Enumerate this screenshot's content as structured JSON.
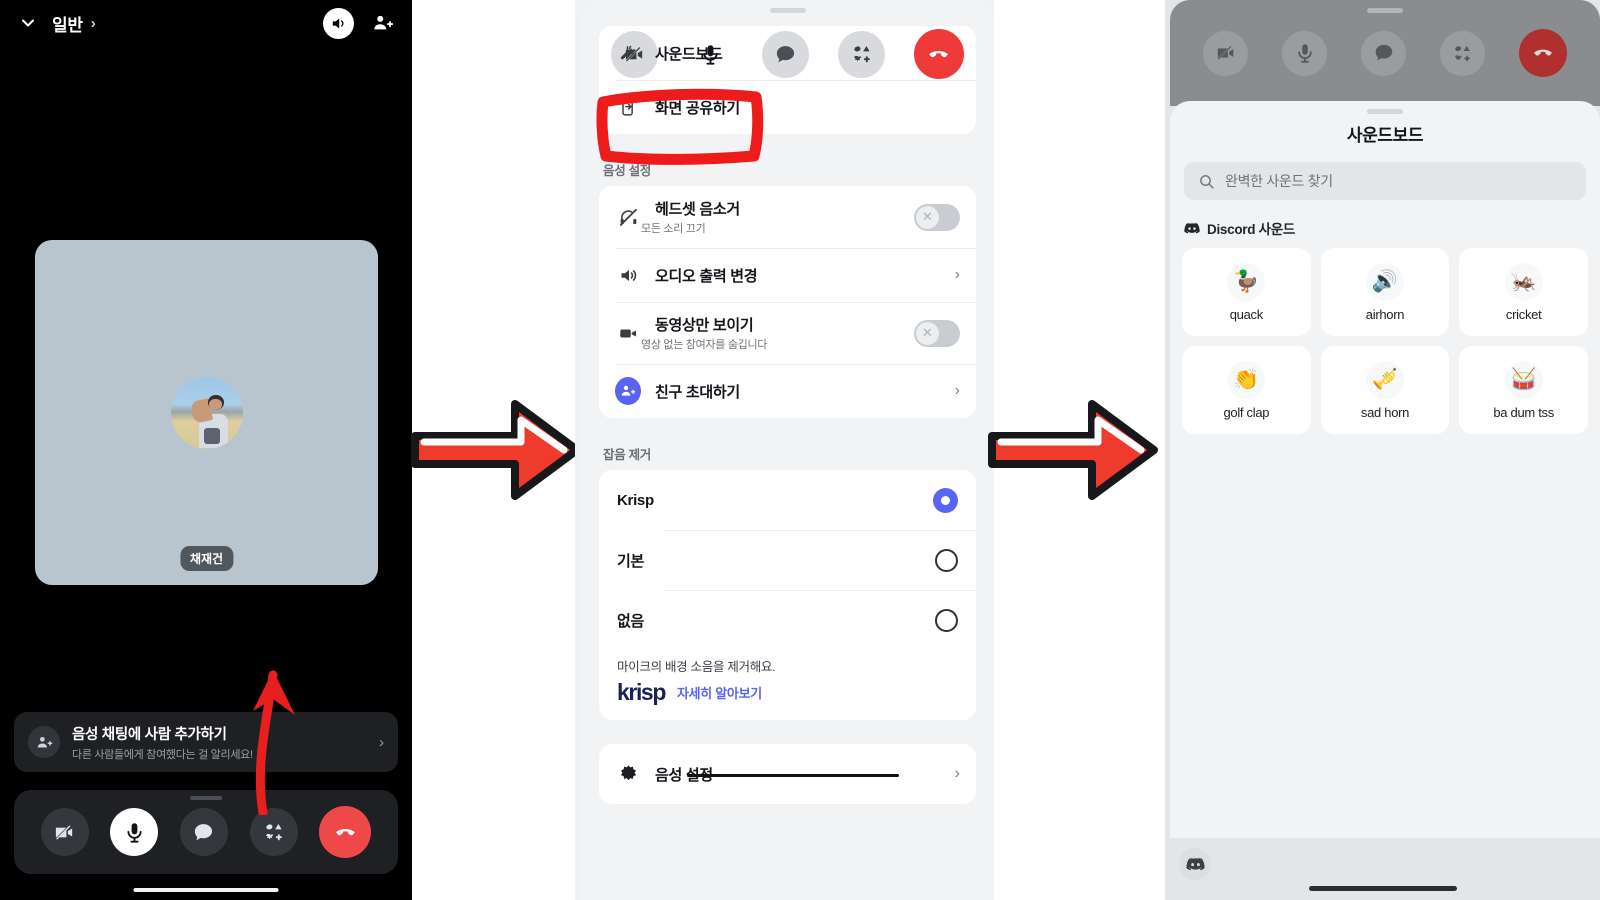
{
  "panel1": {
    "header": {
      "chevron_icon": "chevron-down-icon",
      "title": "일반",
      "title_chevron": "›",
      "speaker_icon": "speaker-icon",
      "add_people_icon": "add-people-icon"
    },
    "tile": {
      "participant_name": "채재건",
      "avatar_icon": "user-avatar"
    },
    "invite_card": {
      "icon": "add-people-icon",
      "title": "음성 채팅에 사람 추가하기",
      "subtitle": "다른 사람들에게 참여했다는 걸 알리세요!",
      "chevron": "›"
    },
    "dock": [
      {
        "name": "camera-off-button",
        "icon": "camera-off-icon",
        "state": "off"
      },
      {
        "name": "microphone-button",
        "icon": "microphone-icon",
        "state": "on"
      },
      {
        "name": "chat-button",
        "icon": "chat-bubble-icon",
        "state": "off"
      },
      {
        "name": "activities-button",
        "icon": "shapes-icon",
        "state": "off"
      },
      {
        "name": "hangup-button",
        "icon": "phone-hangup-icon",
        "state": "danger"
      }
    ],
    "annotation": {
      "type": "curved-arrow-up",
      "color": "#e81f1f"
    }
  },
  "arrows": [
    {
      "name": "step-arrow-1",
      "direction": "right",
      "fill": "#ee3b2b",
      "stroke": "#17181b"
    },
    {
      "name": "step-arrow-2",
      "direction": "right",
      "fill": "#ee3b2b",
      "stroke": "#17181b"
    }
  ],
  "panel2": {
    "toolbar": [
      {
        "name": "camera-off-button",
        "icon": "camera-off-icon",
        "state": "off"
      },
      {
        "name": "microphone-button",
        "icon": "microphone-icon",
        "state": "on"
      },
      {
        "name": "chat-button",
        "icon": "chat-bubble-icon",
        "state": "off"
      },
      {
        "name": "activities-button",
        "icon": "shapes-icon",
        "state": "off"
      },
      {
        "name": "hangup-button",
        "icon": "phone-hangup-icon",
        "state": "danger"
      }
    ],
    "share_card": [
      {
        "icon": "soundboard-icon",
        "label": "사운드보드"
      },
      {
        "icon": "screen-share-icon",
        "label": "화면 공유하기"
      }
    ],
    "voice_section": {
      "title": "음성 설정",
      "rows": [
        {
          "icon": "headset-mute-icon",
          "label": "헤드셋 음소거",
          "sub": "모든 소리 끄기",
          "control": "toggle-off",
          "toggle_glyph": "✕"
        },
        {
          "icon": "speaker-icon",
          "label": "오디오 출력 변경",
          "sub": "",
          "control": "chevron",
          "chevron": "›"
        },
        {
          "icon": "video-camera-icon",
          "label": "동영상만 보이기",
          "sub": "영상 없는 참여자를 숨깁니다",
          "control": "toggle-off",
          "toggle_glyph": "✕"
        },
        {
          "icon": "invite-friend-icon",
          "label": "친구 초대하기",
          "sub": "",
          "control": "chevron",
          "chevron": "›"
        }
      ]
    },
    "noise_section": {
      "title": "잡음 제거",
      "options": [
        {
          "label": "Krisp",
          "selected": true
        },
        {
          "label": "기본",
          "selected": false
        },
        {
          "label": "없음",
          "selected": false
        }
      ],
      "note": "마이크의 배경 소음을 제거해요.",
      "brand": "krisp",
      "link": "자세히 알아보기"
    },
    "bottom_row": {
      "icon": "gear-icon",
      "label": "음성 설정",
      "chevron": "›",
      "strikethrough": true
    },
    "annotation": {
      "type": "red-rectangle",
      "target": "사운드보드",
      "color": "#ee1b1b"
    }
  },
  "panel3": {
    "toolbar": [
      {
        "name": "camera-off-button",
        "icon": "camera-off-icon"
      },
      {
        "name": "microphone-button",
        "icon": "microphone-icon"
      },
      {
        "name": "chat-button",
        "icon": "chat-bubble-icon"
      },
      {
        "name": "activities-button",
        "icon": "shapes-icon"
      },
      {
        "name": "hangup-button",
        "icon": "phone-hangup-icon"
      }
    ],
    "title": "사운드보드",
    "search": {
      "icon": "search-icon",
      "placeholder": "완벽한 사운드 찾기",
      "value": ""
    },
    "section_label": "Discord 사운드",
    "section_icon": "discord-logo-icon",
    "sounds": [
      {
        "label": "quack",
        "emoji": "🦆"
      },
      {
        "label": "airhorn",
        "emoji": "🔊"
      },
      {
        "label": "cricket",
        "emoji": "🦗"
      },
      {
        "label": "golf clap",
        "emoji": "👏"
      },
      {
        "label": "sad horn",
        "emoji": "🎺"
      },
      {
        "label": "ba dum tss",
        "emoji": "🥁"
      }
    ],
    "footer_icon": "discord-logo-icon"
  },
  "colors": {
    "accent_blurple": "#5865f2",
    "danger_red": "#ef3a3a",
    "annotation_red": "#ee1b1b",
    "dark_bg": "#000000",
    "sheet_bg": "#f2f3f5"
  }
}
